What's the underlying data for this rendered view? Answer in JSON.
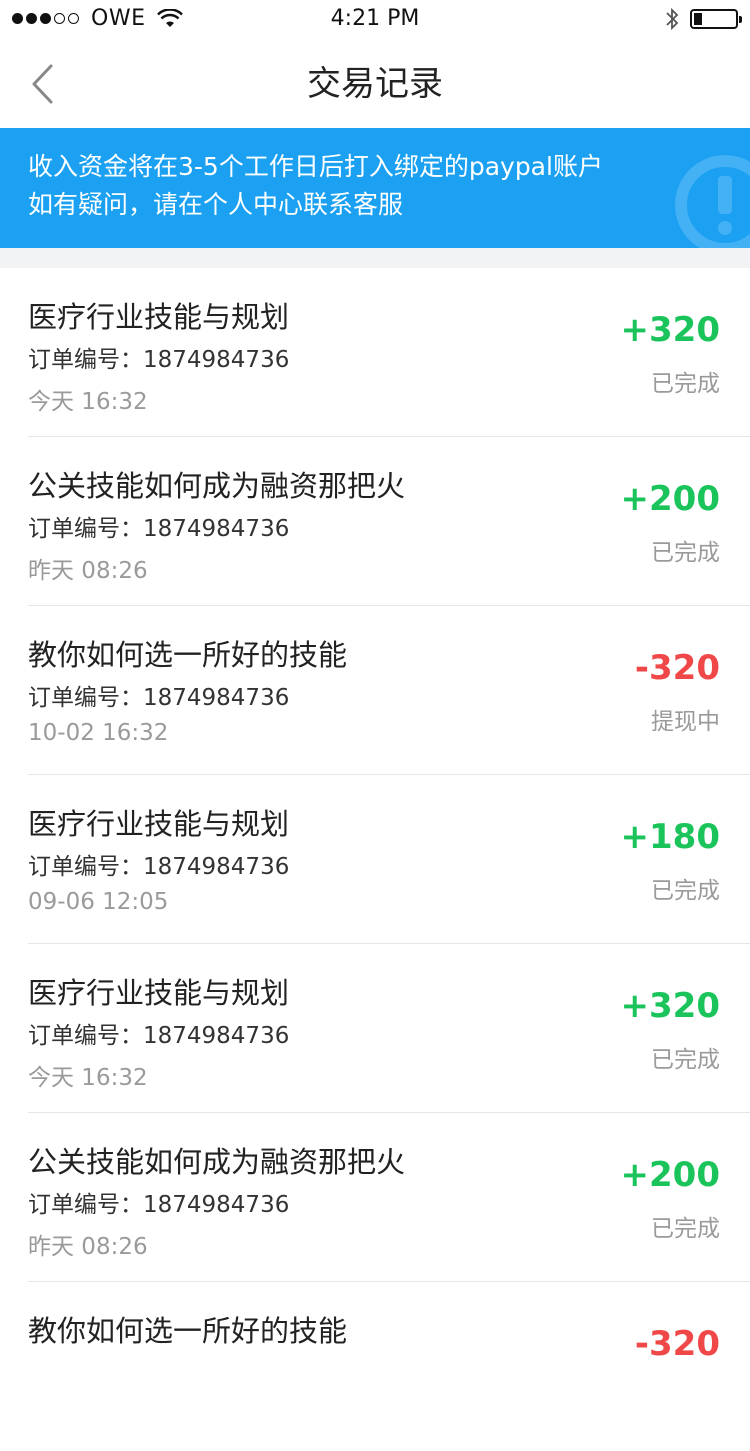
{
  "status_bar": {
    "carrier": "OWE",
    "time": "4:21 PM"
  },
  "nav": {
    "title": "交易记录"
  },
  "notice": {
    "line1": "收入资金将在3-5个工作日后打入绑定的paypal账户",
    "line2": "如有疑问，请在个人中心联系客服"
  },
  "order_label": "订单编号：",
  "transactions": [
    {
      "title": "医疗行业技能与规划",
      "order_no": "1874984736",
      "time": "今天 16:32",
      "amount": "+320",
      "status": "已完成",
      "type": "income"
    },
    {
      "title": "公关技能如何成为融资那把火",
      "order_no": "1874984736",
      "time": "昨天 08:26",
      "amount": "+200",
      "status": "已完成",
      "type": "income"
    },
    {
      "title": "教你如何选一所好的技能",
      "order_no": "1874984736",
      "time": "10-02 16:32",
      "amount": "-320",
      "status": "提现中",
      "type": "outgo"
    },
    {
      "title": "医疗行业技能与规划",
      "order_no": "1874984736",
      "time": "09-06 12:05",
      "amount": "+180",
      "status": "已完成",
      "type": "income"
    },
    {
      "title": "医疗行业技能与规划",
      "order_no": "1874984736",
      "time": "今天 16:32",
      "amount": "+320",
      "status": "已完成",
      "type": "income"
    },
    {
      "title": "公关技能如何成为融资那把火",
      "order_no": "1874984736",
      "time": "昨天 08:26",
      "amount": "+200",
      "status": "已完成",
      "type": "income"
    },
    {
      "title": "教你如何选一所好的技能",
      "order_no": "1874984736",
      "time": "",
      "amount": "-320",
      "status": "",
      "type": "outgo"
    }
  ],
  "colors": {
    "banner": "#1ba0f2",
    "income": "#1bc45a",
    "outgo": "#f04848"
  },
  "icons": {
    "back": "chevron-left-icon",
    "notice": "exclamation-circle-icon",
    "wifi": "wifi-icon",
    "bluetooth": "bluetooth-icon",
    "battery": "battery-icon"
  }
}
